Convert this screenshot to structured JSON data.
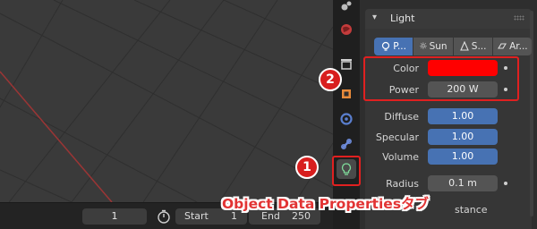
{
  "timeline": {
    "current_frame": "1",
    "start_label": "Start",
    "start_value": "1",
    "end_label": "End",
    "end_value": "250"
  },
  "property_tabs": [
    {
      "icon": "physics-icon"
    },
    {
      "icon": "world-icon"
    },
    {
      "icon": "output-icon"
    },
    {
      "icon": "object-icon"
    },
    {
      "icon": "modifier-icon"
    },
    {
      "icon": "constraints-icon"
    },
    {
      "icon": "object-data-light-icon",
      "active": true
    }
  ],
  "light_panel": {
    "title": "Light",
    "types": [
      {
        "label": "P...",
        "icon": "point-light-icon",
        "active": true
      },
      {
        "label": "Sun",
        "icon": "sun-icon"
      },
      {
        "label": "S...",
        "icon": "spot-light-icon"
      },
      {
        "label": "Ar...",
        "icon": "area-light-icon"
      }
    ],
    "color_label": "Color",
    "color_value": "#ff0000",
    "power_label": "Power",
    "power_value": "200 W",
    "diffuse_label": "Diffuse",
    "diffuse_value": "1.00",
    "specular_label": "Specular",
    "specular_value": "1.00",
    "volume_label": "Volume",
    "volume_value": "1.00",
    "radius_label": "Radius",
    "radius_value": "0.1 m",
    "custom_distance_label": "stance"
  },
  "annotations": {
    "badge_1": "1",
    "badge_2": "2",
    "caption": "Object Data Propertiesタブ"
  },
  "colors": {
    "accent_blue": "#4772b3",
    "annotation_red": "#e02020"
  }
}
